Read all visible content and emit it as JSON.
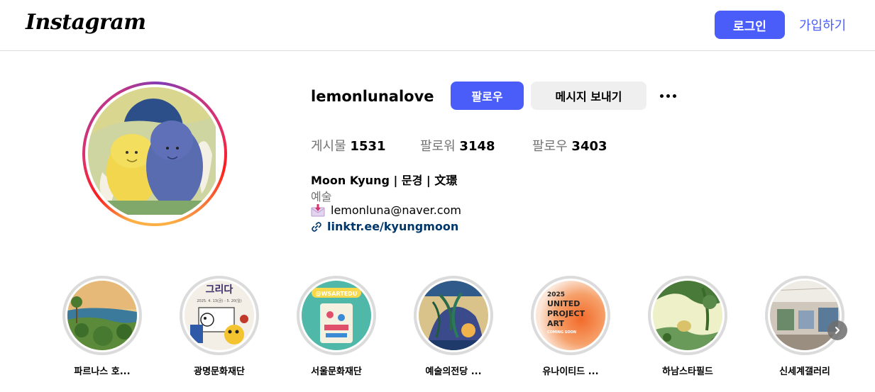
{
  "header": {
    "logo": "Instagram",
    "login_label": "로그인",
    "signup_label": "가입하기"
  },
  "profile": {
    "username": "lemonlunalove",
    "follow_label": "팔로우",
    "message_label": "메시지 보내기",
    "stats": {
      "posts_label": "게시물",
      "posts_count": "1531",
      "followers_label": "팔로워",
      "followers_count": "3148",
      "following_label": "팔로우",
      "following_count": "3403"
    },
    "full_name": "Moon Kyung | 문경 | 文璟",
    "category": "예술",
    "email": "lemonluna@naver.com",
    "link": "linktr.ee/kyungmoon"
  },
  "highlights": [
    {
      "label": "파르나스 호..."
    },
    {
      "label": "광명문화재단"
    },
    {
      "label": "서울문화재단"
    },
    {
      "label": "예술의전당 ..."
    },
    {
      "label": "유나이티드 ..."
    },
    {
      "label": "하남스타필드"
    },
    {
      "label": "신세계갤러리"
    }
  ],
  "highlight_thumbs": {
    "h2_text": "2025. 4. 13(금) - 5. 20(일)",
    "h3_badge": "@WSARTEDU",
    "h5_text": [
      "2025",
      "UNITED",
      "PROJECT",
      "ART",
      "COMING SOON"
    ]
  },
  "colors": {
    "accent": "#4a5df9",
    "link": "#00376b",
    "muted": "#737373",
    "divider": "#dbdbdb"
  }
}
